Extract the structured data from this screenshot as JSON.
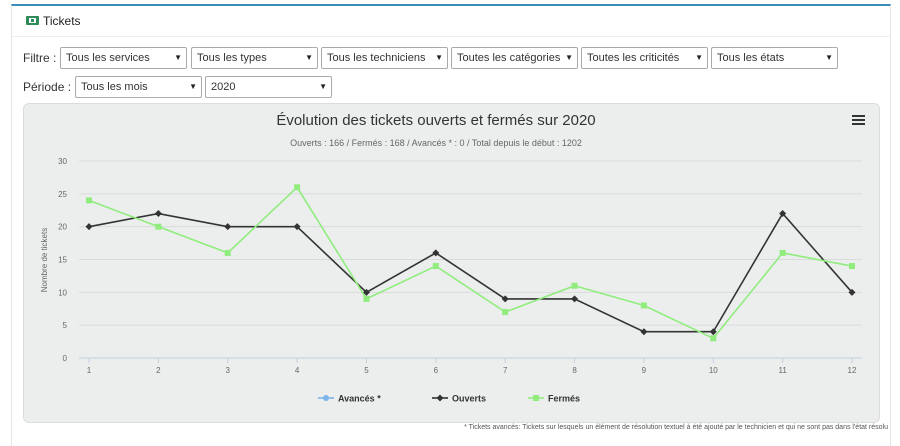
{
  "panel": {
    "title": "Tickets"
  },
  "filters": {
    "filtre_label": "Filtre :",
    "periode_label": "Période :",
    "services": "Tous les services",
    "types": "Tous les types",
    "techniciens": "Tous les techniciens",
    "categories": "Toutes les catégories",
    "criticites": "Toutes les criticités",
    "etats": "Tous les états",
    "mois": "Tous les mois",
    "annee": "2020"
  },
  "footnote": "* Tickets avancés: Tickets sur lesquels un élément de résolution textuel à été ajouté par le technicien et qui ne sont pas dans l'état résolu",
  "colors": {
    "accent": "#3c8dbc",
    "ouverts": "#333333",
    "fermes": "#90ed7d",
    "avances": "#7cb5ec",
    "plot_bg": "#eceeee"
  },
  "chart_data": {
    "type": "line",
    "title": "Évolution des tickets ouverts et fermés sur 2020",
    "subtitle": "Ouverts : 166 / Fermés : 168 / Avancés * : 0 / Total depuis le début : 1202",
    "xlabel": "",
    "ylabel": "Nombre de tickets",
    "categories": [
      "1",
      "2",
      "3",
      "4",
      "5",
      "6",
      "7",
      "8",
      "9",
      "10",
      "11",
      "12"
    ],
    "ylim": [
      0,
      30
    ],
    "yticks": [
      0,
      5,
      10,
      15,
      20,
      25,
      30
    ],
    "grid": true,
    "legend_position": "bottom-center",
    "series": [
      {
        "name": "Avancés *",
        "values": [],
        "color": "#7cb5ec",
        "marker": "circle"
      },
      {
        "name": "Ouverts",
        "values": [
          20,
          22,
          20,
          20,
          10,
          16,
          9,
          9,
          4,
          4,
          22,
          10
        ],
        "color": "#333333",
        "marker": "diamond"
      },
      {
        "name": "Fermés",
        "values": [
          24,
          20,
          16,
          26,
          9,
          14,
          7,
          11,
          8,
          3,
          16,
          14
        ],
        "color": "#90ed7d",
        "marker": "square"
      }
    ]
  }
}
